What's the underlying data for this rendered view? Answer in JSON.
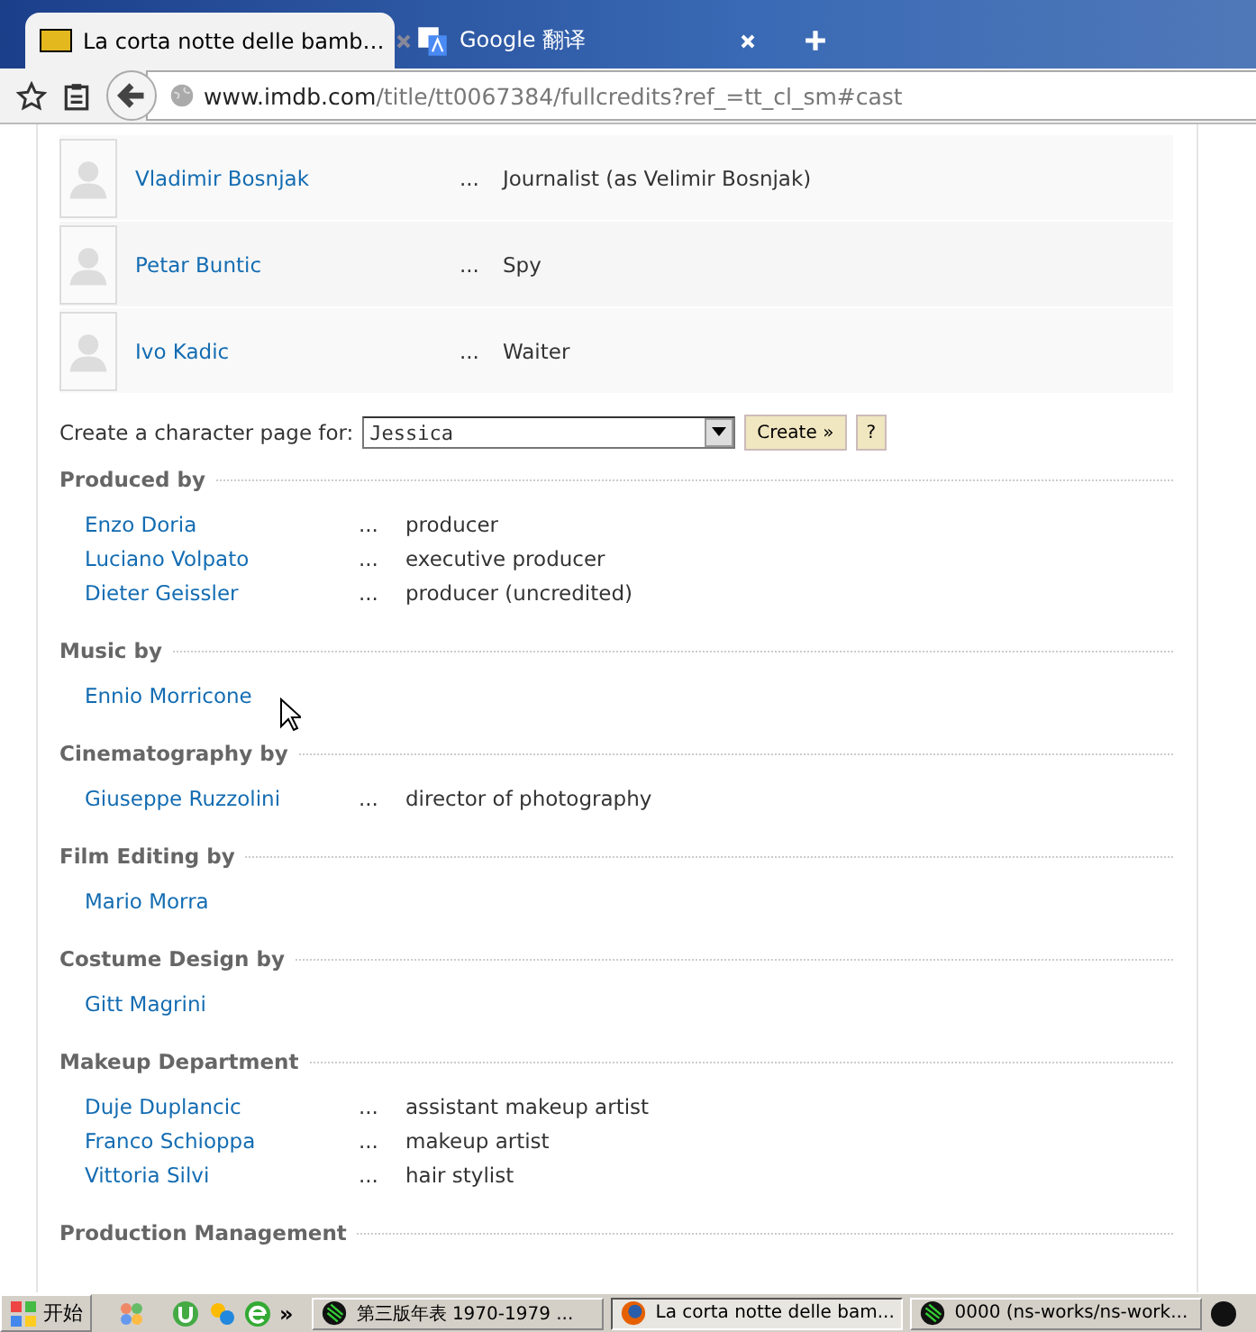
{
  "tabs": [
    {
      "title": "La corta notte delle bamb…",
      "selected": true,
      "kind": "imdb"
    },
    {
      "title": "Google 翻译",
      "selected": false,
      "kind": "translate"
    }
  ],
  "address": {
    "host": "www.imdb.com",
    "path": "/title/tt0067384/fullcredits?ref_=tt_cl_sm#cast"
  },
  "cast": [
    {
      "name": "Vladimir Bosnjak",
      "dots": "...",
      "role": "Journalist (as Velimir Bosnjak)"
    },
    {
      "name": "Petar Buntic",
      "dots": "...",
      "role": "Spy"
    },
    {
      "name": "Ivo Kadic",
      "dots": "...",
      "role": "Waiter"
    }
  ],
  "character_page": {
    "label": "Create a character page for:",
    "value": "Jessica",
    "create": "Create »",
    "help": "?"
  },
  "sections": [
    {
      "title": "Produced by",
      "people": [
        {
          "name": "Enzo Doria",
          "dots": "...",
          "role": "producer"
        },
        {
          "name": "Luciano Volpato",
          "dots": "...",
          "role": "executive producer"
        },
        {
          "name": "Dieter Geissler",
          "dots": "...",
          "role": "producer (uncredited)"
        }
      ]
    },
    {
      "title": "Music by",
      "people": [
        {
          "name": "Ennio Morricone"
        }
      ]
    },
    {
      "title": "Cinematography by",
      "people": [
        {
          "name": "Giuseppe Ruzzolini",
          "dots": "...",
          "role": "director of photography"
        }
      ]
    },
    {
      "title": "Film Editing by",
      "people": [
        {
          "name": "Mario Morra"
        }
      ]
    },
    {
      "title": "Costume Design by",
      "people": [
        {
          "name": "Gitt Magrini"
        }
      ]
    },
    {
      "title": "Makeup Department",
      "people": [
        {
          "name": "Duje Duplancic",
          "dots": "...",
          "role": "assistant makeup artist"
        },
        {
          "name": "Franco Schioppa",
          "dots": "...",
          "role": "makeup artist"
        },
        {
          "name": "Vittoria Silvi",
          "dots": "...",
          "role": "hair stylist"
        }
      ]
    },
    {
      "title": "Production Management"
    }
  ],
  "taskbar": {
    "start": "开始",
    "more": "»",
    "tasks": [
      {
        "title": "第三版年表 1970-1979 ...",
        "selected": false,
        "kind": "app"
      },
      {
        "title": "La corta notte delle bam...",
        "selected": true,
        "kind": "firefox"
      },
      {
        "title": "0000 (ns-works/ns-work...",
        "selected": false,
        "kind": "app"
      }
    ]
  }
}
